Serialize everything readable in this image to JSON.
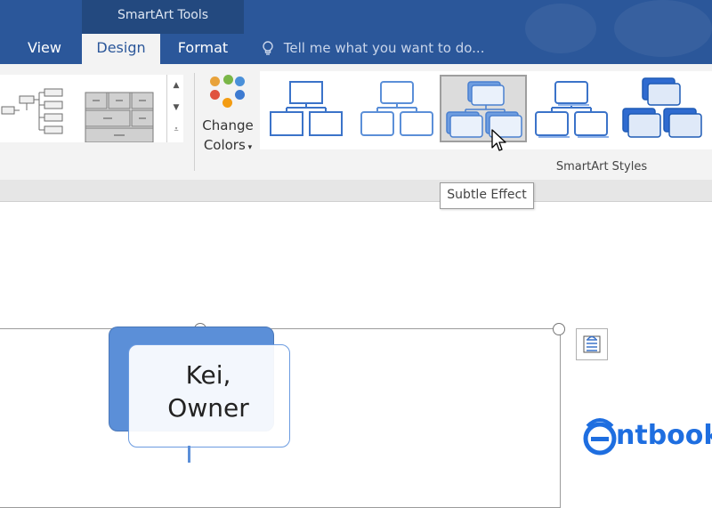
{
  "contextual_tab_group": "SmartArt Tools",
  "tabs": {
    "view": "View",
    "design": "Design",
    "format": "Format"
  },
  "tell_me": {
    "placeholder": "Tell me what you want to do...",
    "icon": "lightbulb-icon"
  },
  "ribbon": {
    "change_colors_line1": "Change",
    "change_colors_line2": "Colors",
    "change_colors_icon_colors": [
      "#e8a23a",
      "#7ab648",
      "#4a90d9",
      "#e0533f",
      "#f39c12",
      "#3e7bd1"
    ],
    "group_label": "SmartArt Styles",
    "selected_style_index": 2
  },
  "tooltip": {
    "text": "Subtle Effect"
  },
  "diagram": {
    "node_line1": "Kei,",
    "node_line2": "Owner",
    "accent_color": "#5b8fd8"
  },
  "watermark": {
    "text": "ntbook"
  },
  "colors": {
    "ribbon_blue": "#2b579a",
    "ribbon_body": "#f3f3f3"
  }
}
